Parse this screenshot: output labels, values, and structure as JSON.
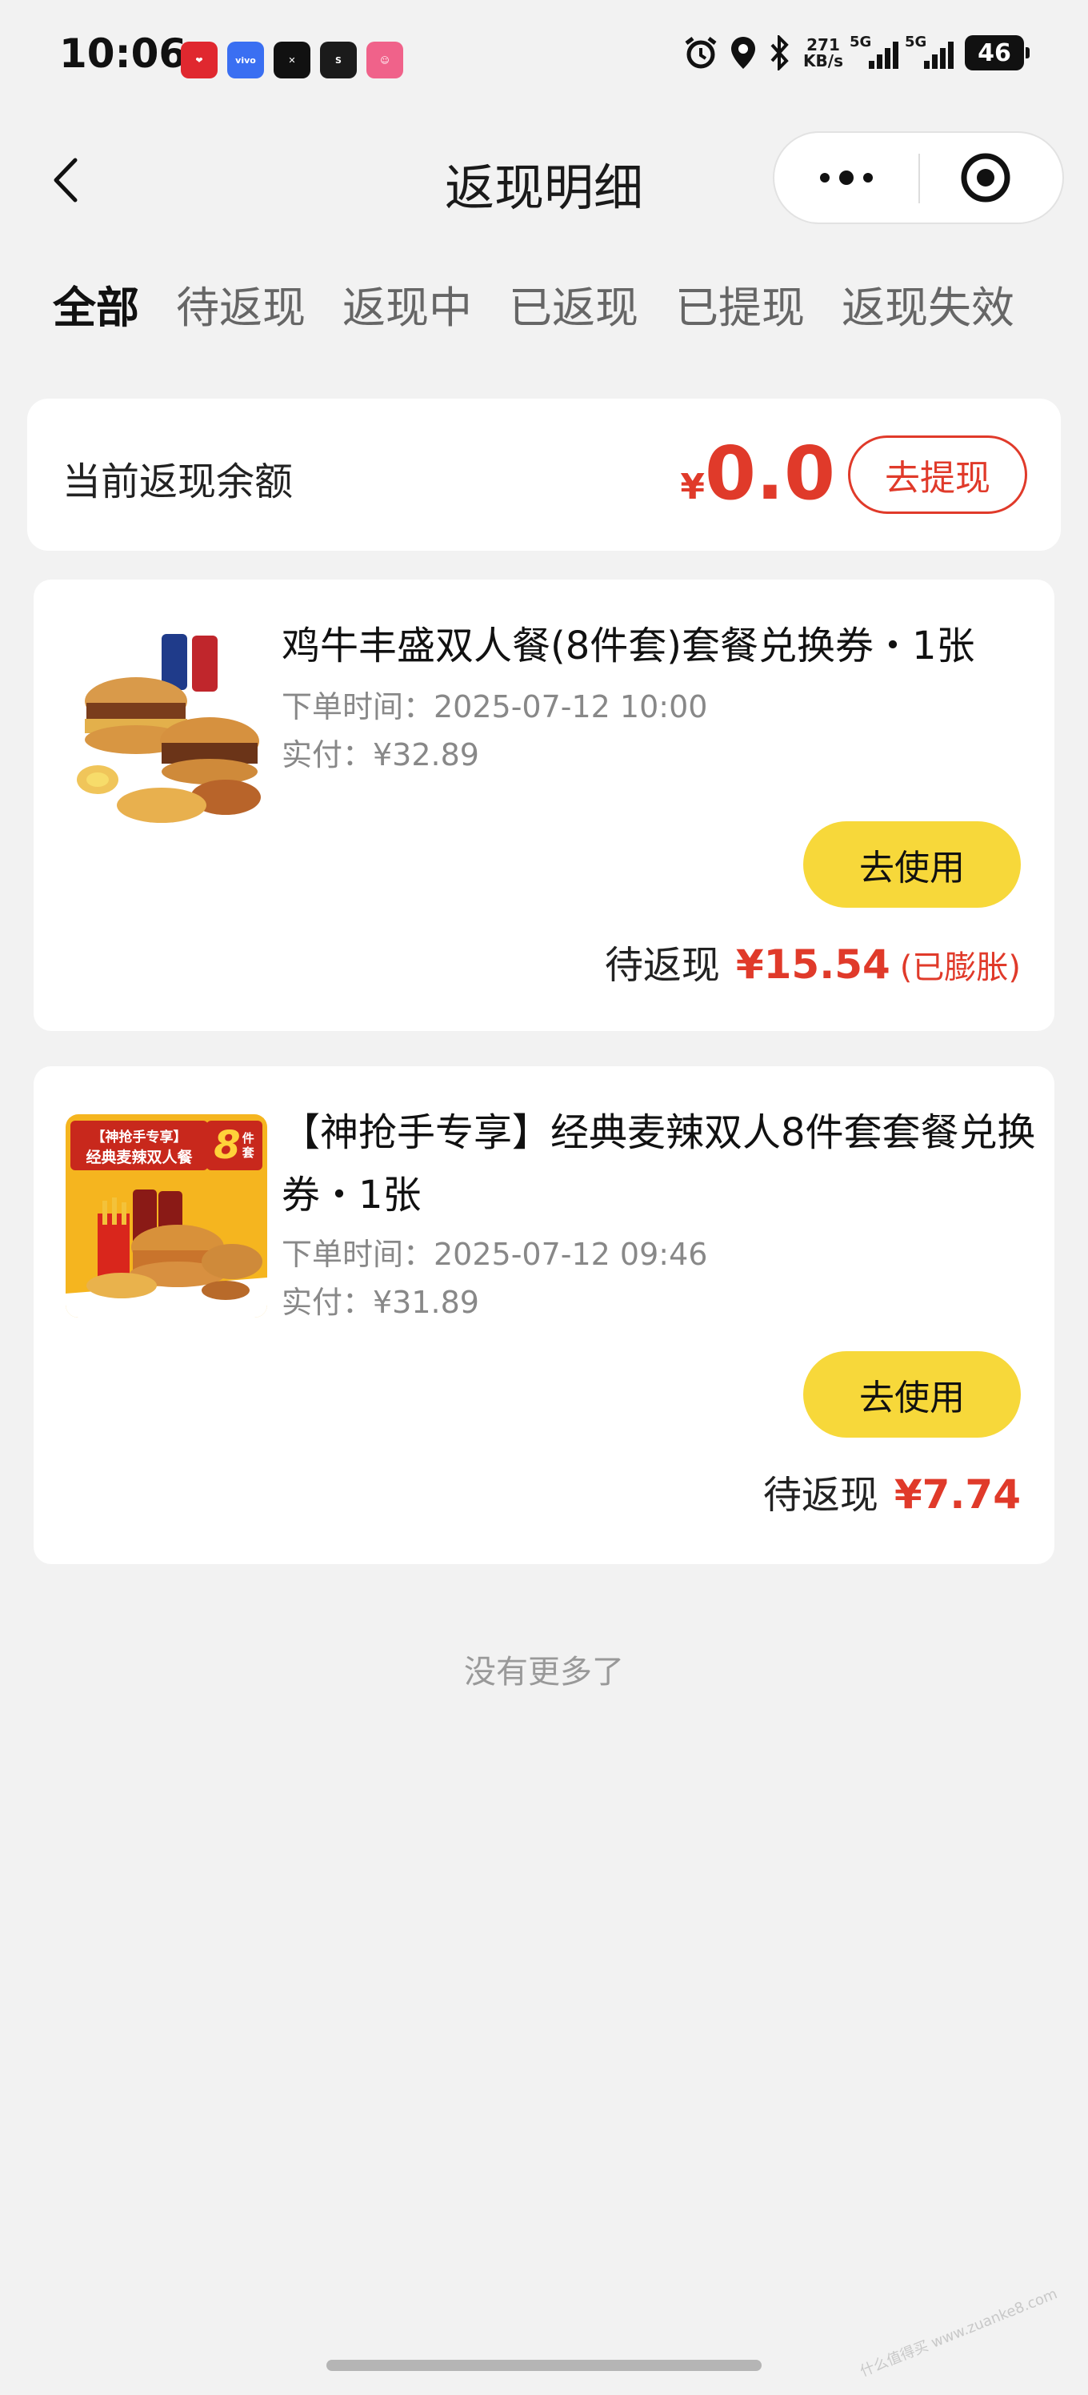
{
  "status_bar": {
    "time": "10:06",
    "speed_value": "271",
    "speed_unit": "KB/s",
    "network_1": "5G",
    "network_2": "5G",
    "battery": "46",
    "app_icons": [
      "pinduoduo-icon",
      "vivo-icon",
      "capcut-icon",
      "soul-icon",
      "cartoon-app-icon"
    ],
    "status_icons": [
      "alarm-icon",
      "location-icon",
      "bluetooth-icon"
    ]
  },
  "navbar": {
    "title": "返现明细",
    "back_icon": "chevron-left-icon",
    "more_icon": "more-dots-icon",
    "close_icon": "target-circle-icon"
  },
  "tabs": [
    {
      "label": "全部",
      "active": true
    },
    {
      "label": "待返现",
      "active": false
    },
    {
      "label": "返现中",
      "active": false
    },
    {
      "label": "已返现",
      "active": false
    },
    {
      "label": "已提现",
      "active": false
    },
    {
      "label": "返现失效",
      "active": false
    }
  ],
  "balance": {
    "label": "当前返现余额",
    "currency": "¥",
    "amount": "0.0",
    "withdraw_label": "去提现"
  },
  "orders": [
    {
      "name": "鸡牛丰盛双人餐(8件套)套餐兑换券・1张",
      "order_time": "下单时间：2025-07-12 10:00",
      "paid": "实付：¥32.89",
      "use_label": "去使用",
      "cashback_label": "待返现",
      "cashback_amount": "¥15.54",
      "cashback_tag": "(已膨胀)"
    },
    {
      "name": "【神抢手专享】经典麦辣双人8件套套餐兑换券・1张",
      "order_time": "下单时间：2025-07-12 09:46",
      "paid": "实付：¥31.89",
      "use_label": "去使用",
      "cashback_label": "待返现",
      "cashback_amount": "¥7.74",
      "cashback_tag": "",
      "thumb_banner_line1": "【神抢手专享】",
      "thumb_banner_line2": "经典麦辣双人餐",
      "thumb_badge_num": "8",
      "thumb_badge_text": "件套"
    }
  ],
  "footer": {
    "no_more": "没有更多了",
    "watermark": "什么值得买 www.zuanke8.com"
  },
  "colors": {
    "accent_red": "#e03a2a",
    "use_button_yellow": "#f7d83a",
    "background": "#f2f2f2"
  }
}
